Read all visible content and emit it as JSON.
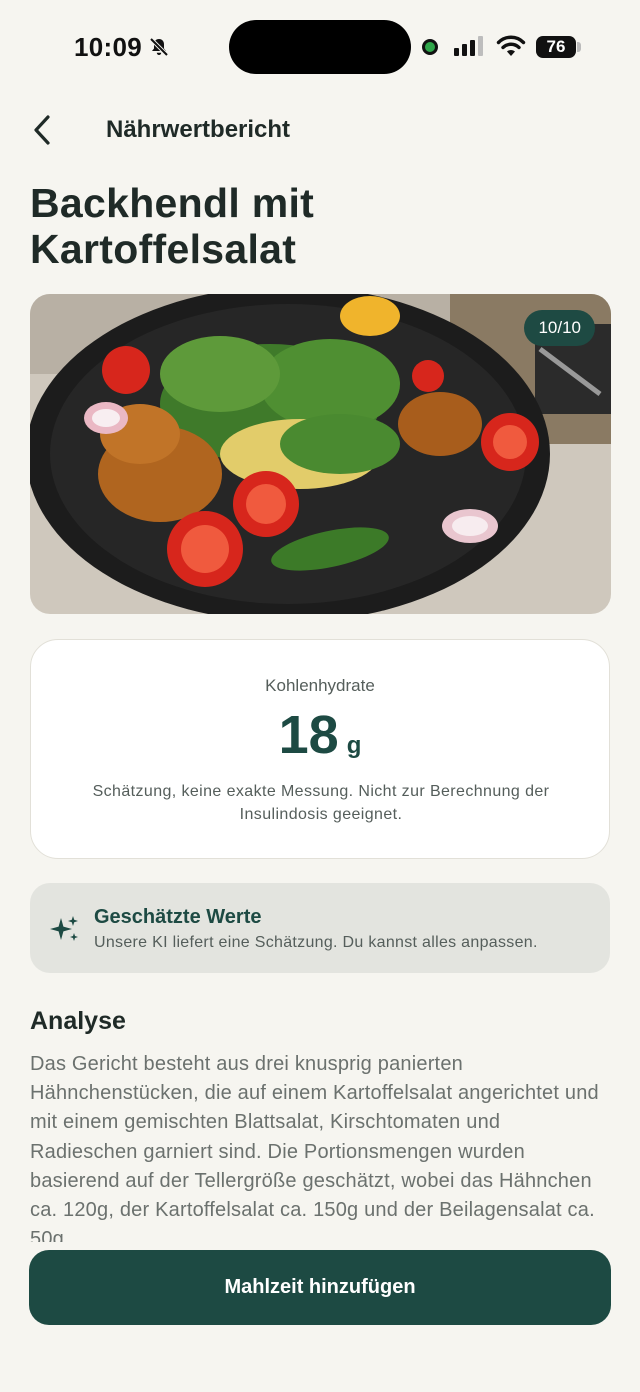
{
  "status_bar": {
    "time": "10:09",
    "battery": "76"
  },
  "header": {
    "back_icon": "chevron-left-icon",
    "nav_title": "Nährwertbericht",
    "page_title": "Backhendl mit Kartoffelsalat"
  },
  "photo": {
    "counter": "10/10"
  },
  "carbs": {
    "label": "Kohlenhydrate",
    "value": "18",
    "unit": "g",
    "note": "Schätzung, keine exakte Messung. Nicht zur Berechnung der Insulindosis geeignet."
  },
  "estimate": {
    "icon": "sparkle-icon",
    "title": "Geschätzte Werte",
    "text": "Unsere KI liefert eine Schätzung. Du kannst alles anpassen."
  },
  "analysis": {
    "heading": "Analyse",
    "text": "Das Gericht besteht aus drei knusprig panierten Hähnchenstücken, die auf einem Kartoffelsalat angerichtet und mit einem gemischten Blattsalat, Kirschtomaten und Radieschen garniert sind. Die Portionsmengen wurden basierend auf der Tellergröße geschätzt, wobei das Hähnchen ca. 120g, der Kartoffelsalat ca. 150g und der Beilagensalat ca. 50g"
  },
  "actions": {
    "add_meal": "Mahlzeit hinzufügen"
  },
  "colors": {
    "background": "#f6f5f0",
    "accent": "#1d4a43",
    "card": "#ffffff",
    "banner": "#e3e4df"
  }
}
